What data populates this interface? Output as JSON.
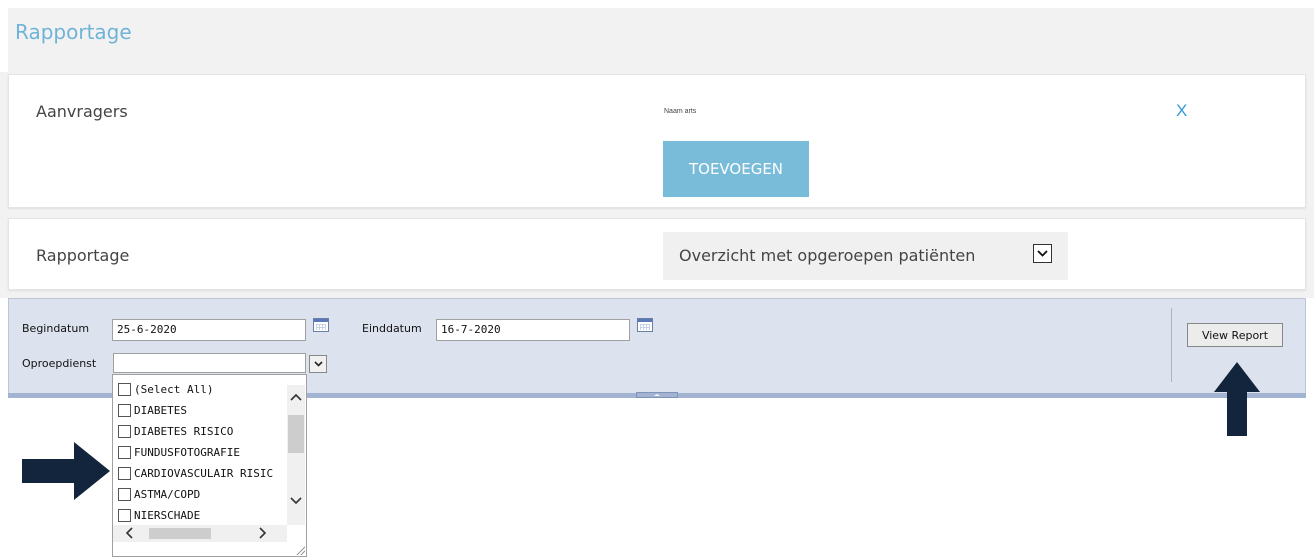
{
  "header": {
    "title": "Rapportage"
  },
  "aanvragers": {
    "label": "Aanvragers",
    "column_label": "Naam arts",
    "close_label": "X",
    "add_button": "TOEVOEGEN"
  },
  "rapportage": {
    "label": "Rapportage",
    "selected": "Overzicht met opgeroepen patiënten"
  },
  "params": {
    "begindatum_label": "Begindatum",
    "begindatum_value": "25-6-2020",
    "einddatum_label": "Einddatum",
    "einddatum_value": "16-7-2020",
    "oproepdienst_label": "Oproepdienst",
    "oproepdienst_value": "",
    "view_report": "View Report"
  },
  "oproepdienst_options": [
    "(Select All)",
    "DIABETES",
    "DIABETES RISICO",
    "FUNDUSFOTOGRAFIE",
    "CARDIOVASCULAIR RISIC",
    "ASTMA/COPD",
    "NIERSCHADE"
  ],
  "icons": {
    "close": "close-icon",
    "calendar": "calendar-icon",
    "dropdown": "chevron-down-icon",
    "annotation_arrow_color": "#13253d"
  }
}
